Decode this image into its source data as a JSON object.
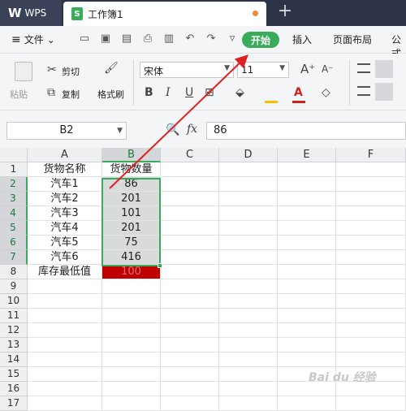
{
  "titlebar": {
    "app_name": "WPS",
    "app_logo": "W",
    "doc_icon": "S",
    "doc_title": "工作簿1",
    "new_tab": "+"
  },
  "menubar": {
    "hamburger": "≡",
    "file_label": "文件",
    "file_caret": "⌄",
    "quick_tools": [
      "folder-icon",
      "save-icon",
      "pdf-icon",
      "print-icon",
      "preview-icon",
      "undo-icon",
      "redo-icon",
      "more-caret-icon"
    ],
    "tabs": [
      "开始",
      "插入",
      "页面布局",
      "公式"
    ],
    "active_tab_color": "#3aaa5b"
  },
  "ribbon": {
    "paste": "粘贴",
    "cut": "剪切",
    "copy": "复制",
    "format_painter": "格式刷",
    "font_name": "宋体",
    "font_size": "11",
    "grow_font": "A⁺",
    "shrink_font": "A⁻",
    "bold": "B",
    "italic": "I",
    "underline": "U",
    "font_color_glyph": "A",
    "font_color": "#d01f1f",
    "fill_color": "#f6c200"
  },
  "formulabar": {
    "name_box": "B2",
    "fx": "fx",
    "formula": "86"
  },
  "sheet": {
    "columns": [
      "A",
      "B",
      "C",
      "D",
      "E",
      "F"
    ],
    "rows": [
      "1",
      "2",
      "3",
      "4",
      "5",
      "6",
      "7",
      "8",
      "9",
      "10",
      "11",
      "12",
      "13",
      "14",
      "15",
      "16",
      "17"
    ],
    "cells": {
      "A1": "货物名称",
      "B1": "货物数量",
      "A2": "汽车1",
      "B2": "86",
      "A3": "汽车2",
      "B3": "201",
      "A4": "汽车3",
      "B4": "101",
      "A5": "汽车4",
      "B5": "201",
      "A6": "汽车5",
      "B6": "75",
      "A7": "汽车6",
      "B7": "416",
      "A8": "库存最低值",
      "B8": "100"
    },
    "selection": "B2:B7",
    "highlight_color": "#c00000"
  },
  "watermark": "Bai du 经验"
}
